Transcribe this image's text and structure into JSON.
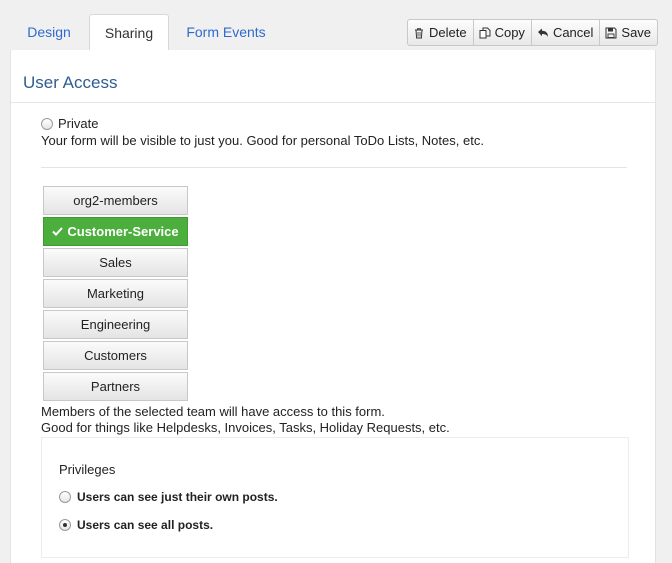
{
  "tabs": [
    {
      "label": "Design"
    },
    {
      "label": "Sharing"
    },
    {
      "label": "Form Events"
    }
  ],
  "toolbar": {
    "delete_label": "Delete",
    "copy_label": "Copy",
    "cancel_label": "Cancel",
    "save_label": "Save"
  },
  "section": {
    "title": "User Access"
  },
  "private_option": {
    "label": "Private",
    "description": "Your form will be visible to just you. Good for personal ToDo Lists, Notes, etc."
  },
  "teams": [
    {
      "label": "org2-members",
      "selected": false
    },
    {
      "label": "Customer-Service",
      "selected": true
    },
    {
      "label": "Sales",
      "selected": false
    },
    {
      "label": "Marketing",
      "selected": false
    },
    {
      "label": "Engineering",
      "selected": false
    },
    {
      "label": "Customers",
      "selected": false
    },
    {
      "label": "Partners",
      "selected": false
    }
  ],
  "team_description": {
    "line1": "Members of the selected team will have access to this form.",
    "line2": "Good for things like Helpdesks, Invoices, Tasks, Holiday Requests, etc."
  },
  "privileges": {
    "title": "Privileges",
    "options": [
      {
        "label": "Users can see just their own posts.",
        "checked": false
      },
      {
        "label": "Users can see all posts.",
        "checked": true
      }
    ]
  },
  "colors": {
    "selected_team": "#4caf3d",
    "link": "#2f6ad0",
    "section_title": "#2e5e8f"
  }
}
